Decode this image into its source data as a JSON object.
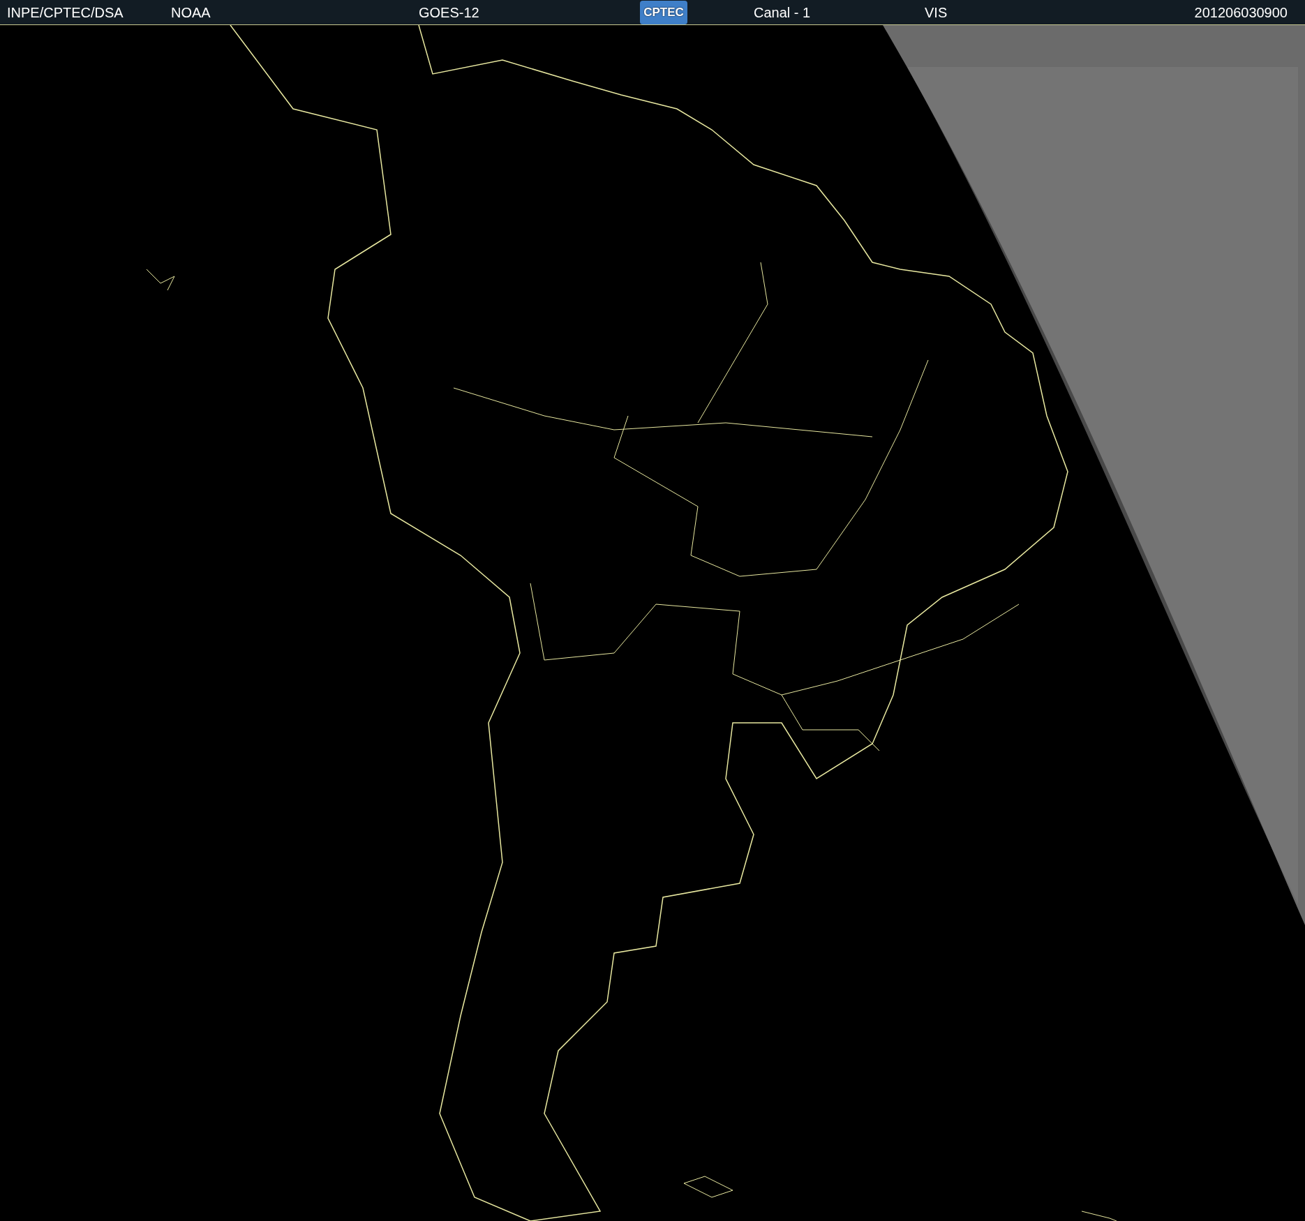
{
  "header": {
    "source": "INPE/CPTEC/DSA",
    "agency": "NOAA",
    "satellite": "GOES-12",
    "logo": "CPTEC",
    "channel": "Canal - 1",
    "band": "VIS",
    "timestamp": "201206030900"
  }
}
